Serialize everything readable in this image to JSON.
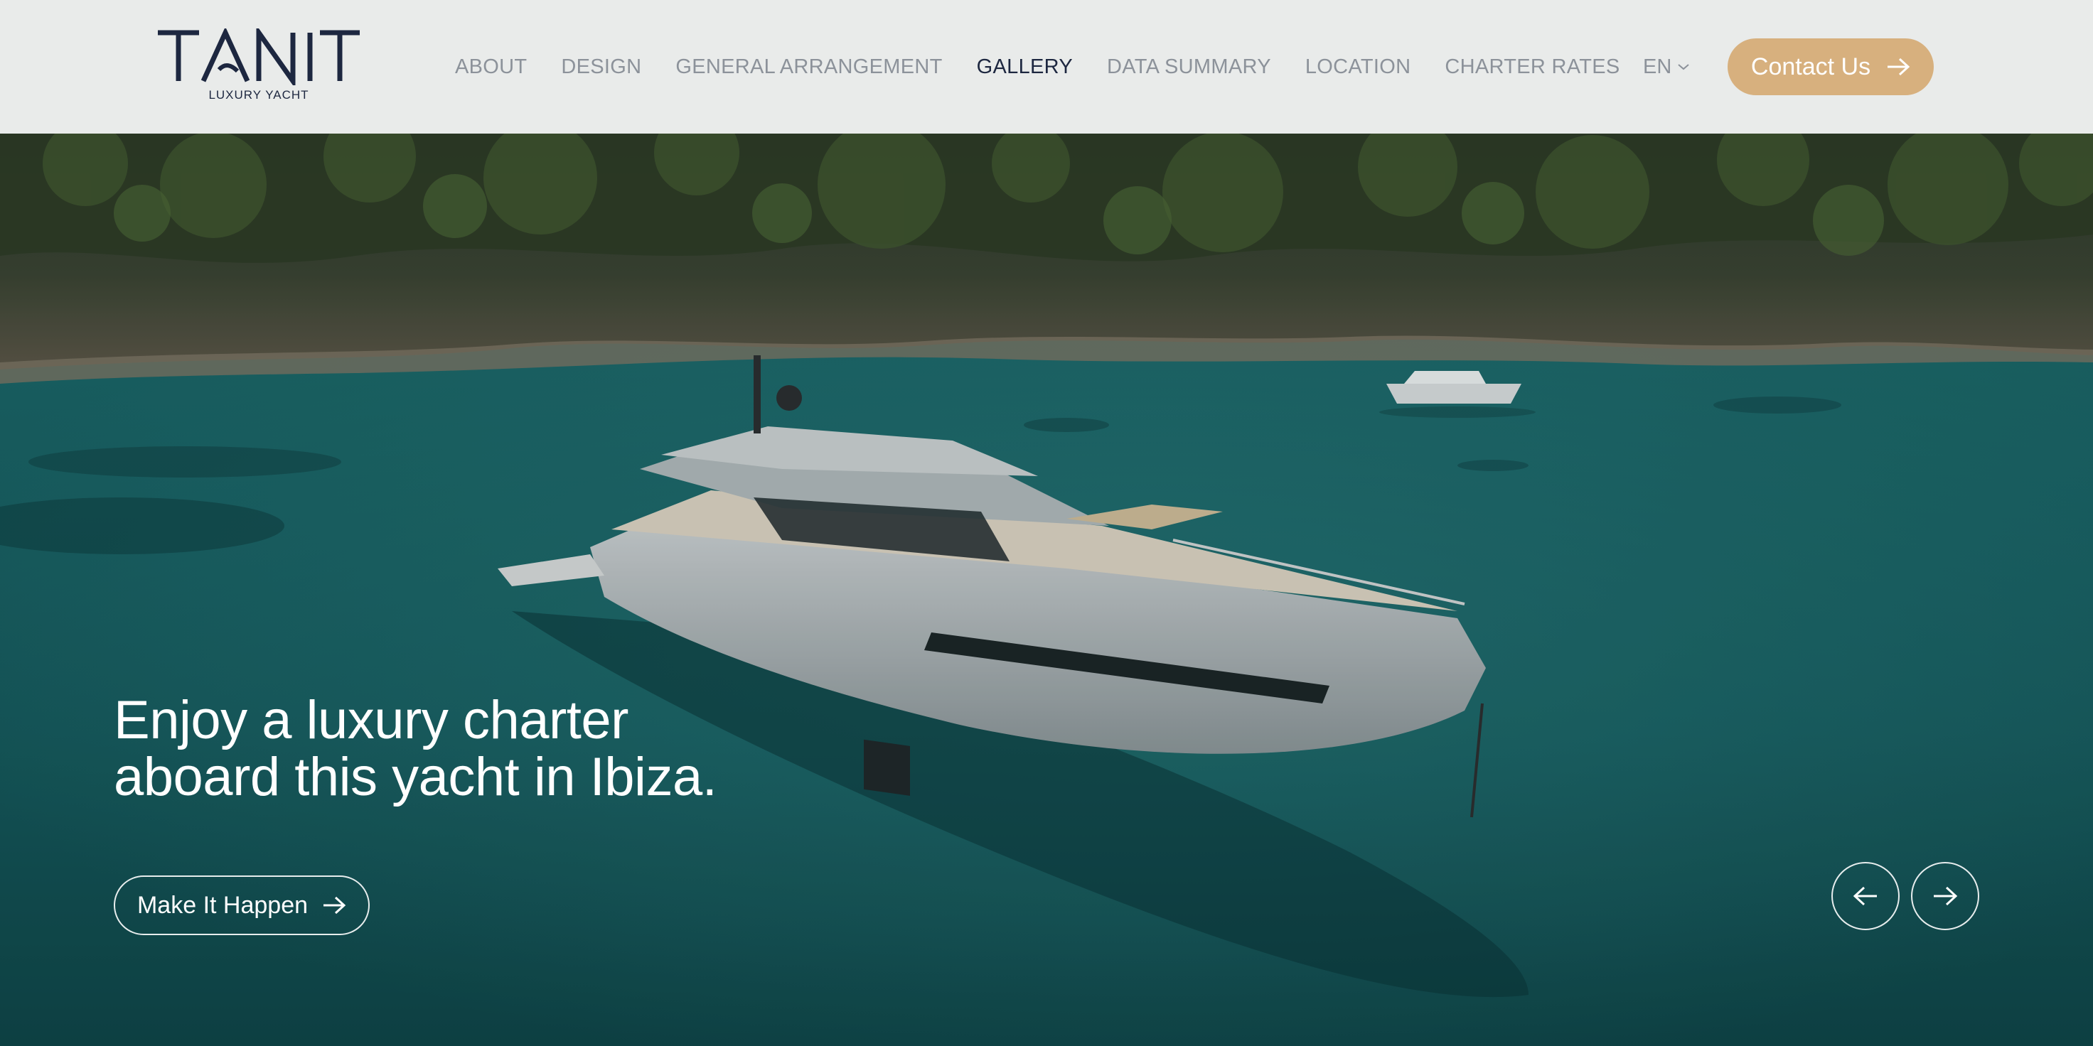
{
  "brand": {
    "name": "TANIT",
    "tagline": "LUXURY YACHT"
  },
  "nav": {
    "items": [
      {
        "label": "ABOUT",
        "active": false
      },
      {
        "label": "DESIGN",
        "active": false
      },
      {
        "label": "GENERAL ARRANGEMENT",
        "active": false
      },
      {
        "label": "GALLERY",
        "active": true
      },
      {
        "label": "DATA SUMMARY",
        "active": false
      },
      {
        "label": "LOCATION",
        "active": false
      },
      {
        "label": "CHARTER RATES",
        "active": false
      }
    ]
  },
  "language": {
    "selected": "EN",
    "icon": "chevron-down-icon"
  },
  "contact": {
    "label": "Contact Us",
    "icon": "arrow-right-icon"
  },
  "hero": {
    "headline_line1": "Enjoy a luxury charter",
    "headline_line2": "aboard this yacht in Ibiza.",
    "cta_label": "Make It Happen",
    "cta_icon": "arrow-right-icon",
    "prev_icon": "arrow-left-icon",
    "next_icon": "arrow-right-icon"
  },
  "colors": {
    "header_bg": "#e9ebea",
    "brand_navy": "#1d2740",
    "nav_inactive": "#8c929a",
    "accent_gold": "#d7b07e",
    "water_teal": "#1a5a5e"
  }
}
